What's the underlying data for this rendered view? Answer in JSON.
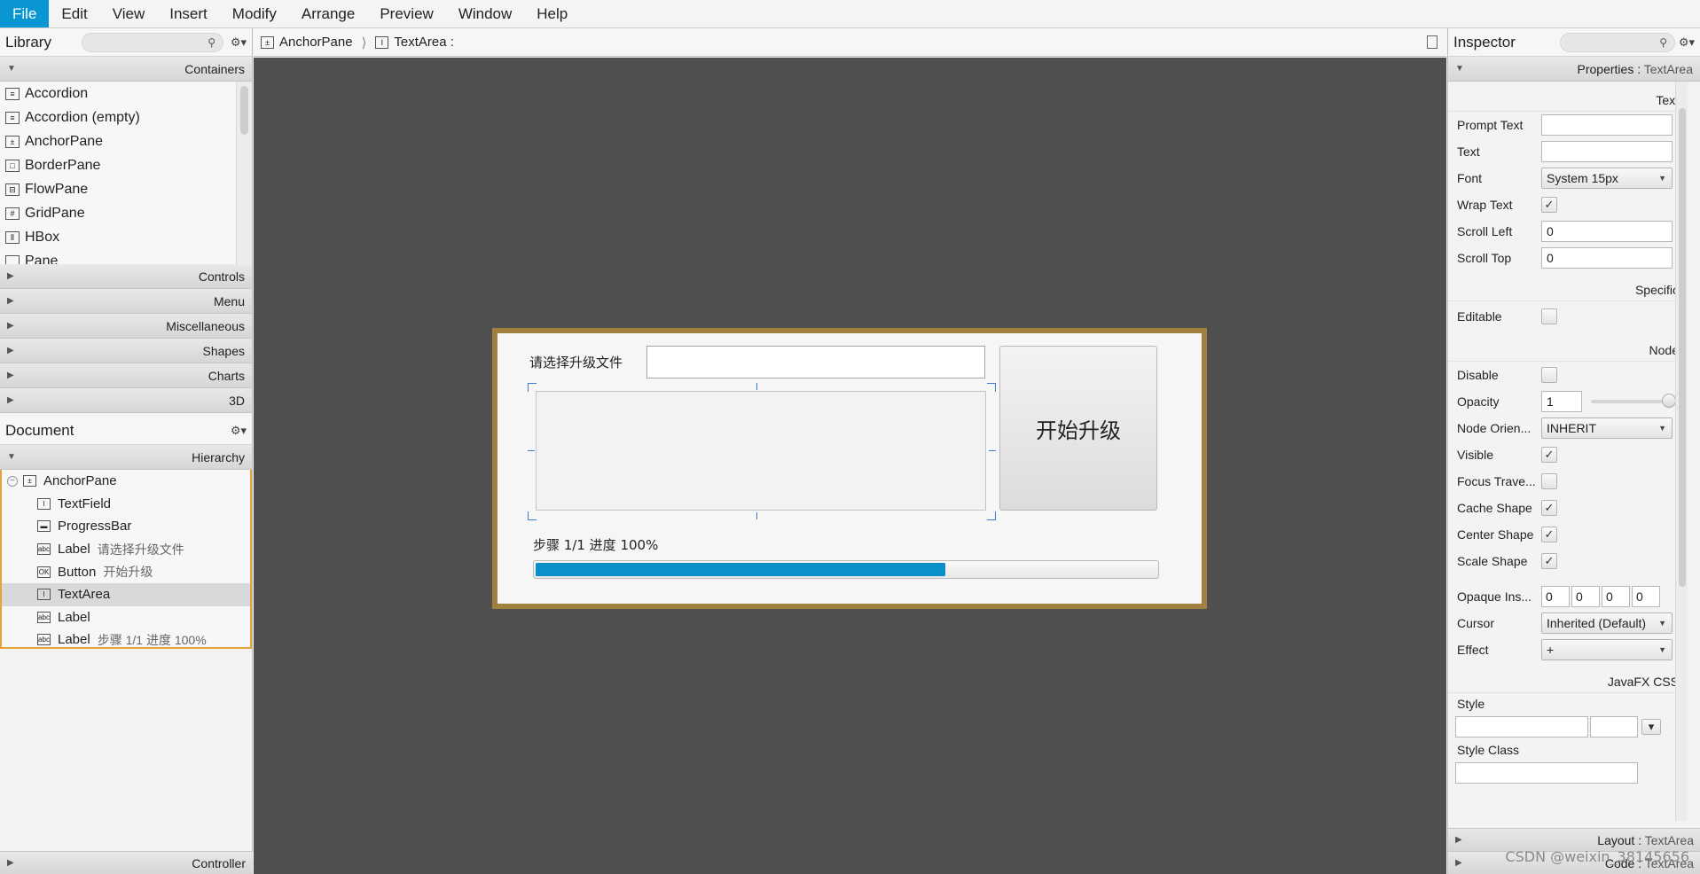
{
  "menubar": {
    "items": [
      "File",
      "Edit",
      "View",
      "Insert",
      "Modify",
      "Arrange",
      "Preview",
      "Window",
      "Help"
    ]
  },
  "library": {
    "title": "Library",
    "sections": {
      "containers": "Containers",
      "controls": "Controls",
      "menu": "Menu",
      "misc": "Miscellaneous",
      "shapes": "Shapes",
      "charts": "Charts",
      "threed": "3D"
    },
    "containers": [
      "Accordion",
      "Accordion  (empty)",
      "AnchorPane",
      "BorderPane",
      "FlowPane",
      "GridPane",
      "HBox",
      "Pane"
    ]
  },
  "document": {
    "title": "Document",
    "hierarchy_label": "Hierarchy",
    "controller_label": "Controller",
    "tree": [
      {
        "type": "AnchorPane",
        "sub": ""
      },
      {
        "type": "TextField",
        "sub": ""
      },
      {
        "type": "ProgressBar",
        "sub": ""
      },
      {
        "type": "Label",
        "sub": "请选择升级文件"
      },
      {
        "type": "Button",
        "sub": "开始升级"
      },
      {
        "type": "TextArea",
        "sub": ""
      },
      {
        "type": "Label",
        "sub": ""
      },
      {
        "type": "Label",
        "sub": "步骤 1/1 进度 100%"
      }
    ]
  },
  "breadcrumb": {
    "root": "AnchorPane",
    "current": "TextArea :"
  },
  "design": {
    "label_select": "请选择升级文件",
    "button": "开始升级",
    "status": "步骤 1/1 进度 100%",
    "progress": 0.66
  },
  "inspector": {
    "title": "Inspector",
    "properties_prefix": "Properties :",
    "properties_target": "TextArea",
    "groups": {
      "text": "Text",
      "specific": "Specific",
      "node": "Node",
      "css": "JavaFX CSS"
    },
    "prompt_text": "Prompt Text",
    "text": "Text",
    "font": "Font",
    "font_value": "System 15px",
    "wrap_text": "Wrap Text",
    "scroll_left": "Scroll Left",
    "scroll_left_value": "0",
    "scroll_top": "Scroll Top",
    "scroll_top_value": "0",
    "editable": "Editable",
    "disable": "Disable",
    "opacity": "Opacity",
    "opacity_value": "1",
    "node_orientation": "Node Orien...",
    "node_orientation_value": "INHERIT",
    "visible": "Visible",
    "focus_traversable": "Focus Trave...",
    "cache_shape": "Cache Shape",
    "center_shape": "Center Shape",
    "scale_shape": "Scale Shape",
    "opaque_insets": "Opaque Ins...",
    "opaque_values": [
      "0",
      "0",
      "0",
      "0"
    ],
    "cursor": "Cursor",
    "cursor_value": "Inherited (Default)",
    "effect": "Effect",
    "effect_value": "+",
    "style": "Style",
    "style_class": "Style Class",
    "layout_label": "Layout :",
    "layout_target": "TextArea",
    "code_label": "Code :",
    "code_target": "TextArea"
  },
  "watermark": "CSDN @weixin_38145656"
}
